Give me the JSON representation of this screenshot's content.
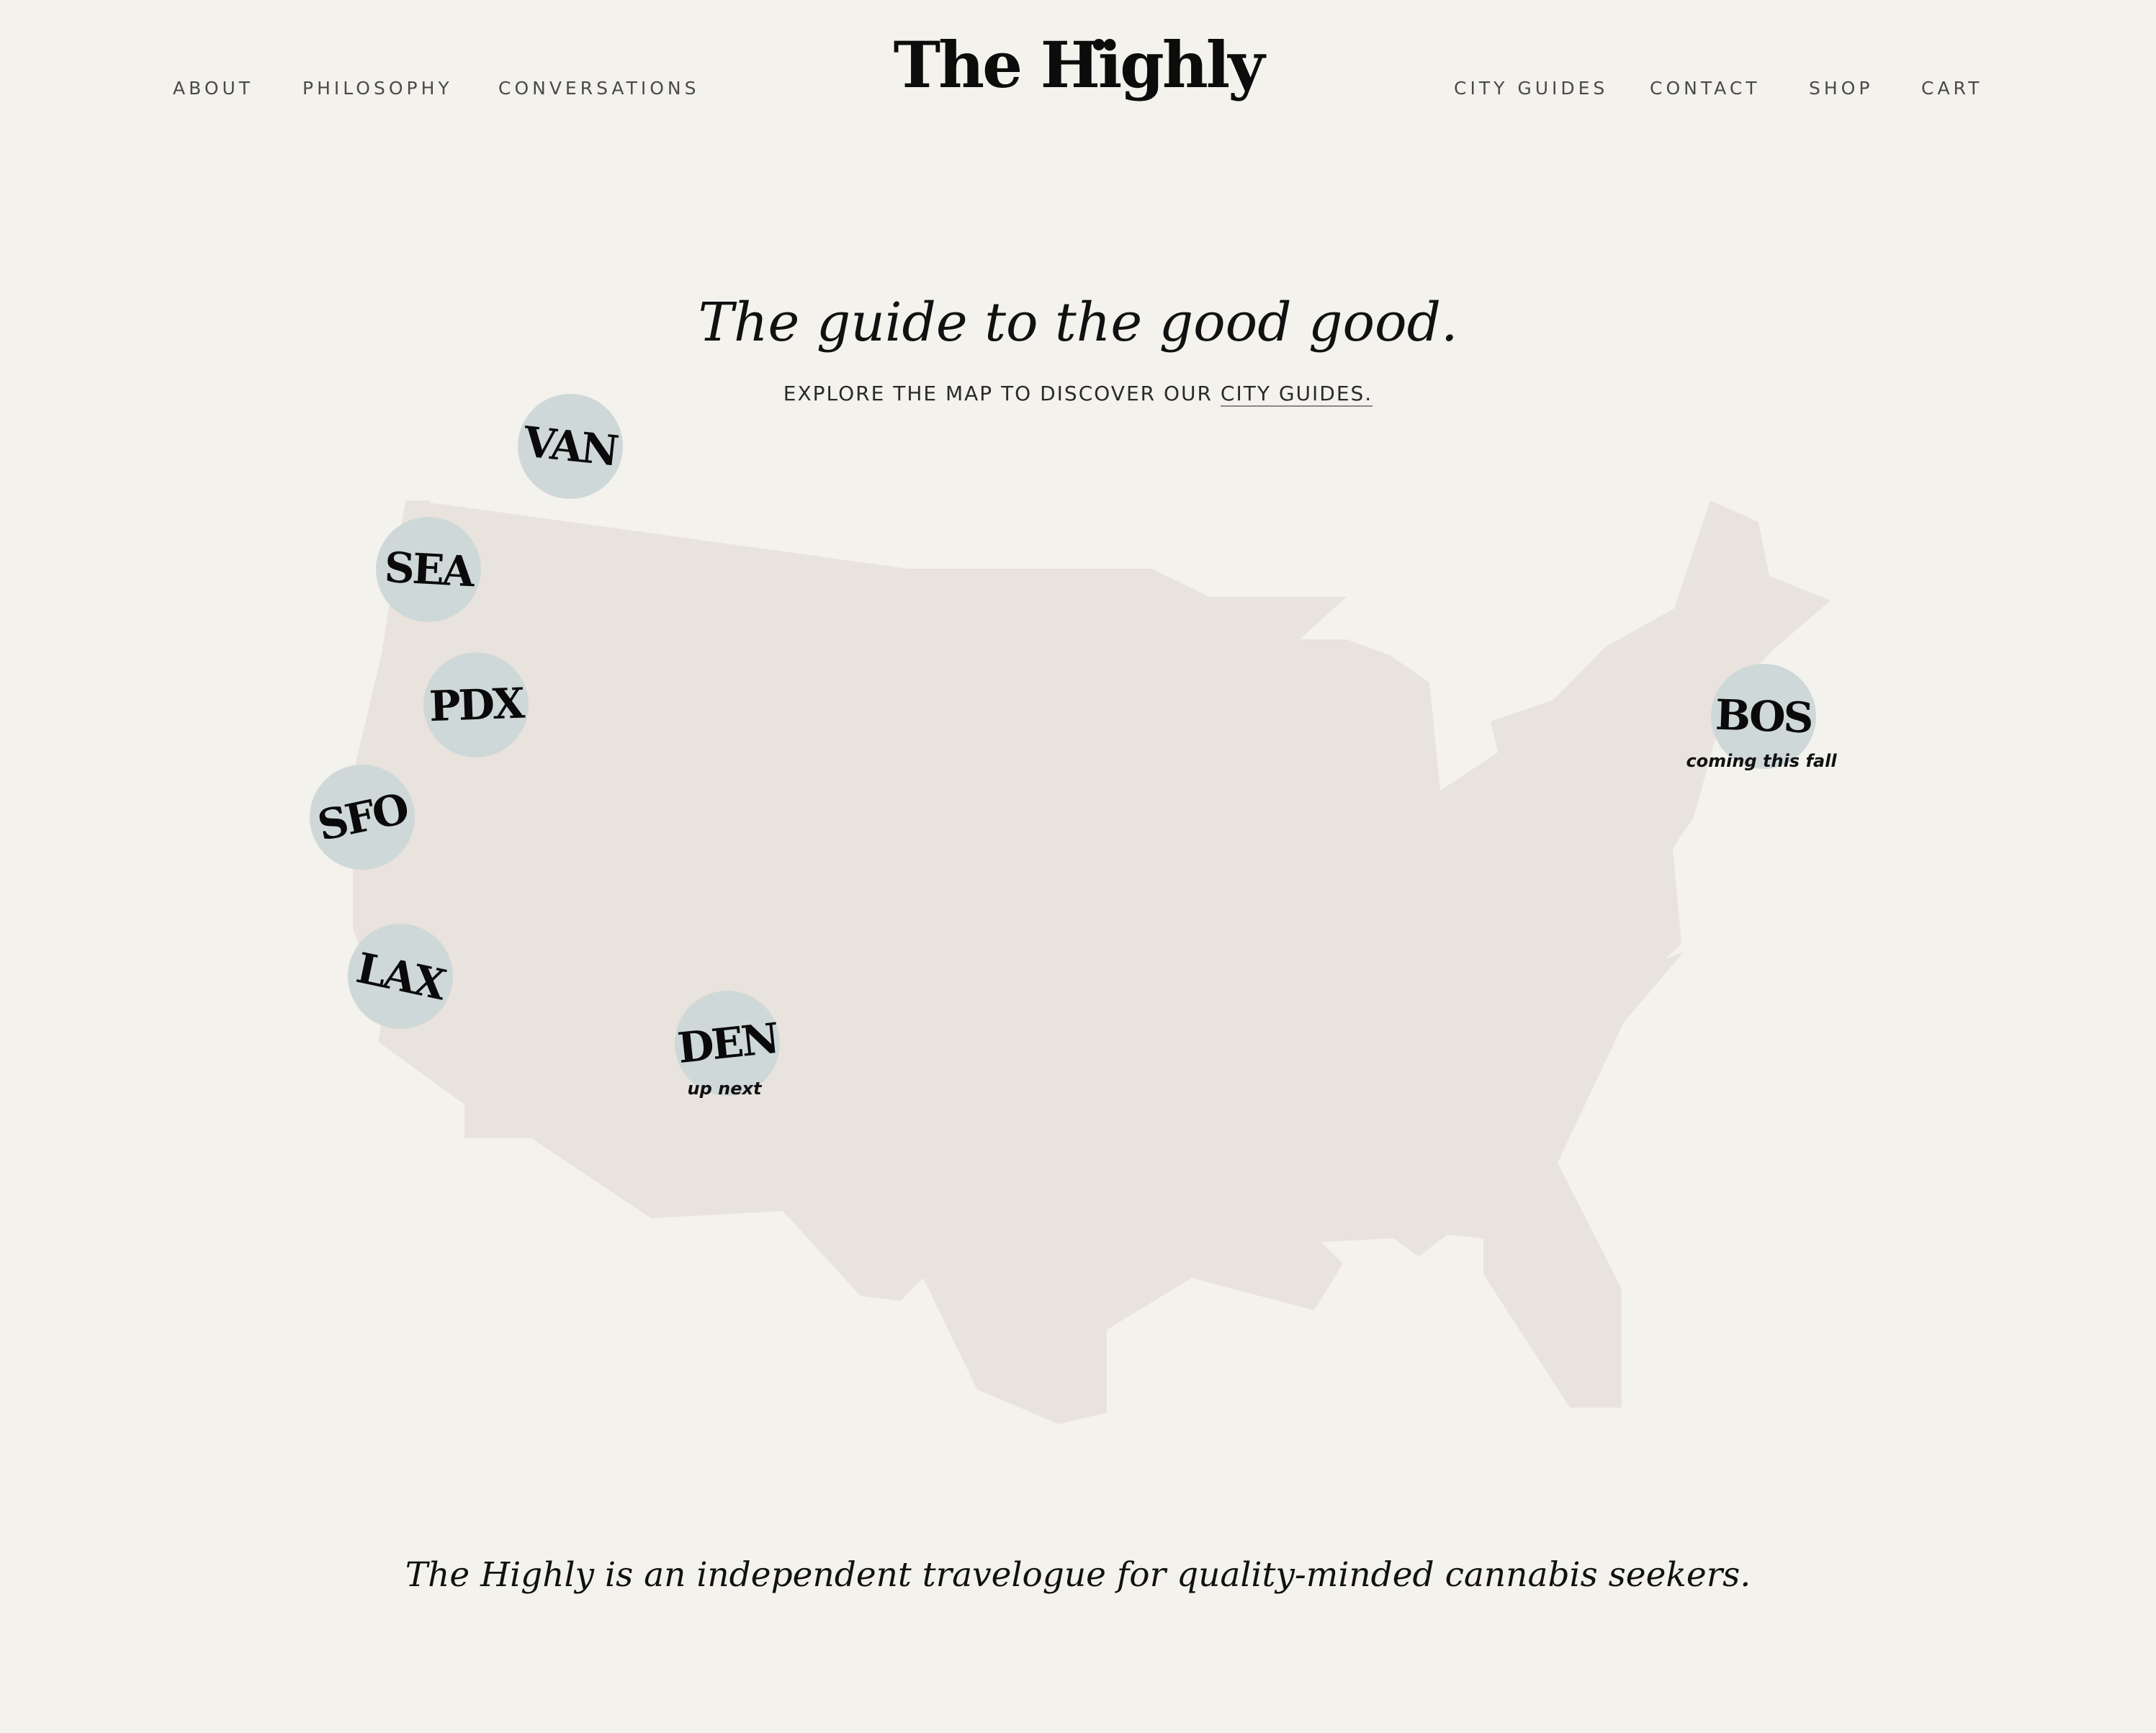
{
  "nav_left": [
    "ABOUT",
    "PHILOSOPHY",
    "CONVERSATIONS"
  ],
  "logo": "The Highly",
  "nav_right": [
    "CITY GUIDES",
    "CONTACT",
    "SHOP",
    "CART"
  ],
  "hero": {
    "headline": "The guide to the good good.",
    "subtitle_prefix": "EXPLORE THE MAP TO DISCOVER OUR ",
    "subtitle_link": "CITY GUIDES."
  },
  "map": {
    "region_color": "#e9e3dd",
    "pin_color": "#cfd8d8",
    "cities": [
      {
        "code": "VAN",
        "note": ""
      },
      {
        "code": "SEA",
        "note": ""
      },
      {
        "code": "PDX",
        "note": ""
      },
      {
        "code": "SFO",
        "note": ""
      },
      {
        "code": "LAX",
        "note": ""
      },
      {
        "code": "DEN",
        "note": "up next"
      },
      {
        "code": "BOS",
        "note": "coming this fall"
      }
    ]
  },
  "tagline": "The Highly is an independent travelogue for quality-minded cannabis seekers."
}
